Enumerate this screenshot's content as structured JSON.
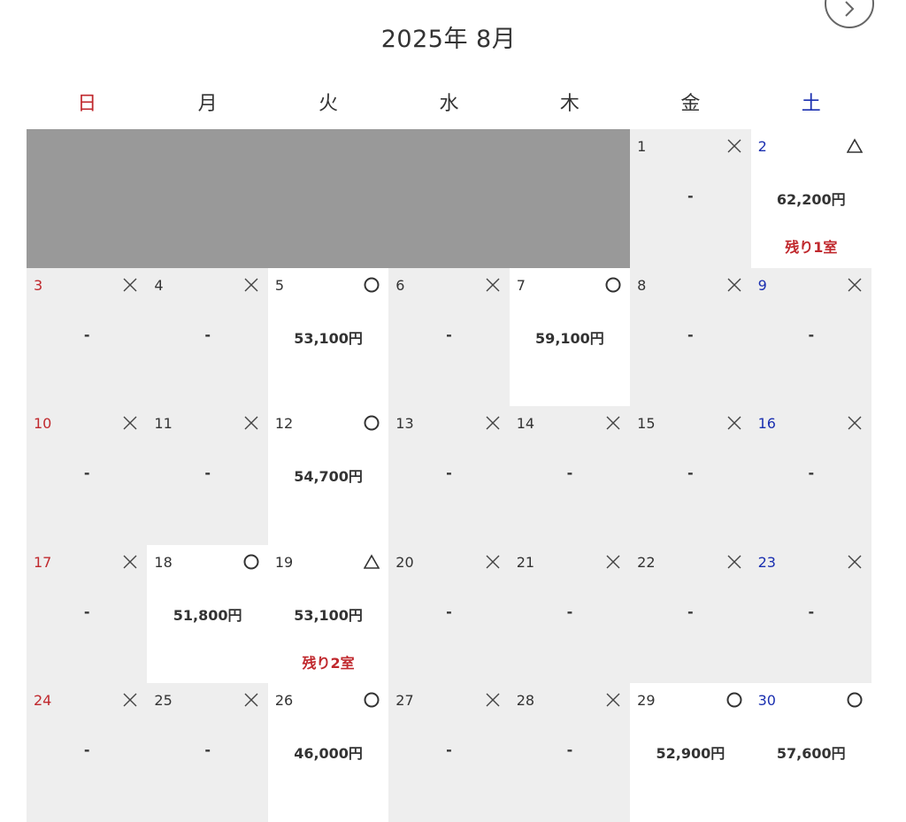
{
  "calendar": {
    "title": "2025年 8月",
    "next_icon": "chevron-right-icon",
    "weekdays": [
      "日",
      "月",
      "火",
      "水",
      "木",
      "金",
      "土"
    ],
    "leading_blank_days": 5,
    "colors": {
      "sunday": "#c0282d",
      "saturday": "#1a2fb0",
      "unavailable_bg": "#eeeeee",
      "available_bg": "#ffffff",
      "outside_month_bg": "#999999",
      "remaining_text": "#c0282d"
    },
    "days": [
      {
        "day": "1",
        "mark": "×",
        "price": "-"
      },
      {
        "day": "2",
        "mark": "△",
        "price": "62,200円",
        "remaining": "残り1室"
      },
      {
        "day": "3",
        "mark": "×",
        "price": "-"
      },
      {
        "day": "4",
        "mark": "×",
        "price": "-"
      },
      {
        "day": "5",
        "mark": "○",
        "price": "53,100円"
      },
      {
        "day": "6",
        "mark": "×",
        "price": "-"
      },
      {
        "day": "7",
        "mark": "○",
        "price": "59,100円"
      },
      {
        "day": "8",
        "mark": "×",
        "price": "-"
      },
      {
        "day": "9",
        "mark": "×",
        "price": "-"
      },
      {
        "day": "10",
        "mark": "×",
        "price": "-"
      },
      {
        "day": "11",
        "mark": "×",
        "price": "-"
      },
      {
        "day": "12",
        "mark": "○",
        "price": "54,700円"
      },
      {
        "day": "13",
        "mark": "×",
        "price": "-"
      },
      {
        "day": "14",
        "mark": "×",
        "price": "-"
      },
      {
        "day": "15",
        "mark": "×",
        "price": "-"
      },
      {
        "day": "16",
        "mark": "×",
        "price": "-"
      },
      {
        "day": "17",
        "mark": "×",
        "price": "-"
      },
      {
        "day": "18",
        "mark": "○",
        "price": "51,800円"
      },
      {
        "day": "19",
        "mark": "△",
        "price": "53,100円",
        "remaining": "残り2室"
      },
      {
        "day": "20",
        "mark": "×",
        "price": "-"
      },
      {
        "day": "21",
        "mark": "×",
        "price": "-"
      },
      {
        "day": "22",
        "mark": "×",
        "price": "-"
      },
      {
        "day": "23",
        "mark": "×",
        "price": "-"
      },
      {
        "day": "24",
        "mark": "×",
        "price": "-"
      },
      {
        "day": "25",
        "mark": "×",
        "price": "-"
      },
      {
        "day": "26",
        "mark": "○",
        "price": "46,000円"
      },
      {
        "day": "27",
        "mark": "×",
        "price": "-"
      },
      {
        "day": "28",
        "mark": "×",
        "price": "-"
      },
      {
        "day": "29",
        "mark": "○",
        "price": "52,900円"
      },
      {
        "day": "30",
        "mark": "○",
        "price": "57,600円"
      }
    ]
  }
}
